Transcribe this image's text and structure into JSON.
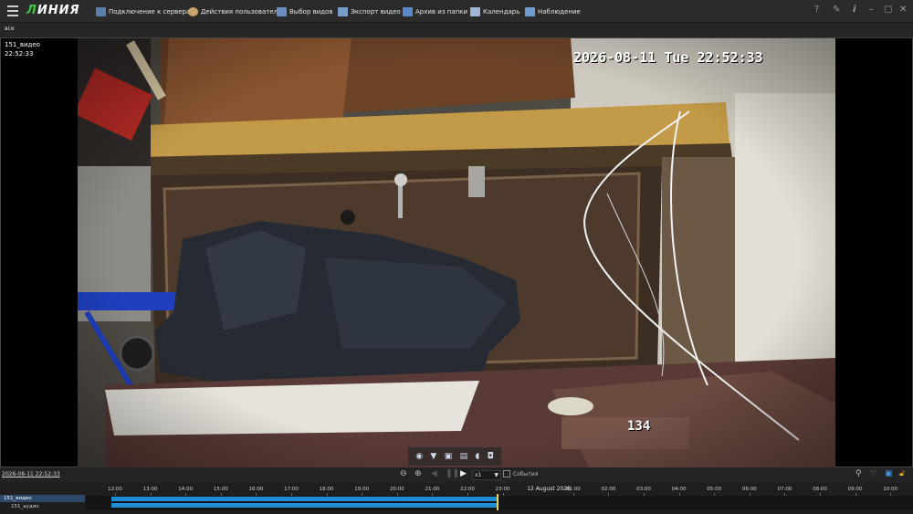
{
  "app": {
    "logo_prefix": "Л",
    "logo_rest": "ИНИЯ"
  },
  "menu": [
    {
      "label": "Подключение к серверам",
      "icon": "servers-icon",
      "color": "#5a7fa8"
    },
    {
      "label": "Действия пользователя",
      "icon": "user-actions-icon",
      "color": "#c8a36a"
    },
    {
      "label": "Выбор видов",
      "icon": "views-icon",
      "color": "#6b8fc4"
    },
    {
      "label": "Экспорт видео",
      "icon": "export-icon",
      "color": "#7a9ec8"
    },
    {
      "label": "Архив из папки",
      "icon": "folder-archive-icon",
      "color": "#5b86c8"
    },
    {
      "label": "Календарь",
      "icon": "calendar-icon",
      "color": "#9fb6d6"
    },
    {
      "label": "Наблюдение",
      "icon": "monitor-icon",
      "color": "#6f9bd1"
    }
  ],
  "tabs": {
    "all": "все"
  },
  "camera": {
    "name": "151_видео",
    "time": "22:52:33",
    "osd_timestamp": "2026-08-11 Tue 22:52:33",
    "osd_number": "134"
  },
  "controls": {
    "current_datetime": "2026-08-11 22:52:33",
    "speed": "x1",
    "events_label": "События"
  },
  "timeline": {
    "tracks": [
      {
        "label": "151_видео",
        "selected": true
      },
      {
        "label": "151_аудио",
        "selected": false
      }
    ],
    "hours": [
      "12:00",
      "13:00",
      "14:00",
      "15:00",
      "16:00",
      "17:00",
      "18:00",
      "19:00",
      "20:00",
      "21:00",
      "22:00",
      "23:00",
      "01:00",
      "02:00",
      "03:00",
      "04:00",
      "05:00",
      "06:00",
      "07:00",
      "08:00",
      "09:00",
      "10:00"
    ],
    "day_label": "12 August 2026",
    "accent": "#1e8fd6",
    "cursor_color": "#e8d35c"
  }
}
